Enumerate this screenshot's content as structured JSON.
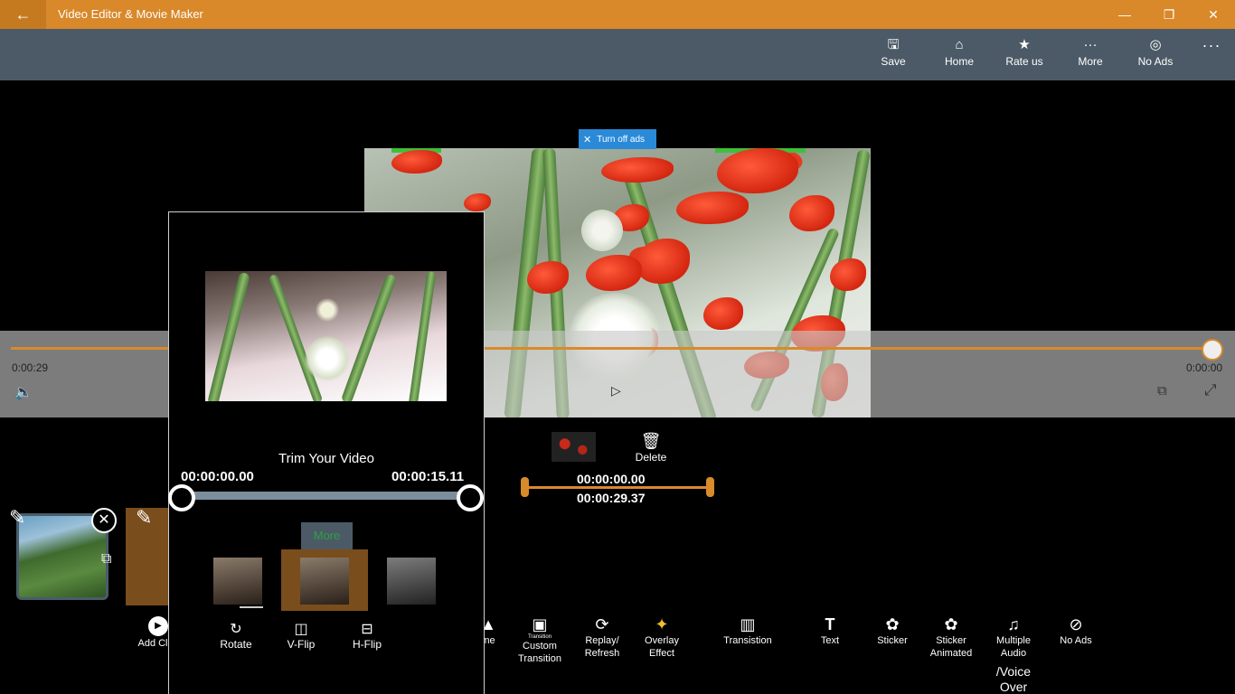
{
  "app": {
    "title": "Video Editor & Movie Maker",
    "back_icon": "back-arrow-icon"
  },
  "window_controls": {
    "minimize": "—",
    "restore": "❐",
    "close": "✕"
  },
  "command_bar": {
    "items": [
      {
        "label": "Save",
        "icon": "save-icon",
        "glyph": "🖫"
      },
      {
        "label": "Home",
        "icon": "home-icon",
        "glyph": "⌂"
      },
      {
        "label": "Rate us",
        "icon": "star-icon",
        "glyph": "★"
      },
      {
        "label": "More",
        "icon": "more-icon",
        "glyph": "···"
      },
      {
        "label": "No Ads",
        "icon": "no-ads-icon",
        "glyph": "◎"
      }
    ],
    "overflow": "···"
  },
  "ad": {
    "label": "Turn off ads",
    "close": "✕"
  },
  "player": {
    "time_elapsed": "0:00:29",
    "time_remaining": "0:00:00",
    "progress": 1.0,
    "volume_glyph": "🔈",
    "play_glyph": "▷",
    "cast_glyph": "⧉",
    "fullscreen_glyph": "⤢"
  },
  "clip_editor": {
    "delete_label": "Delete",
    "delete_glyph": "🗑",
    "start_time": "00:00:00.00",
    "end_time": "00:00:29.37"
  },
  "clips": {
    "add_label": "Add Cl",
    "add_glyph": "▶",
    "close_glyph": "✕",
    "edit_glyph": "✎",
    "copy_glyph": "⧉"
  },
  "toolbar": {
    "frame_label": "me",
    "custom_transition_label": "Custom Transition",
    "custom_transition_small": "Transition",
    "replay_label": "Replay/ Refresh",
    "overlay_label": "Overlay Effect",
    "transistion_label": "Transistion",
    "text_label": "Text",
    "sticker_label": "Sticker",
    "sticker_animated_label": "Sticker Animated",
    "multiple_audio_label": "Multiple Audio",
    "no_ads_label": "No Ads",
    "voice_over_label": "/Voice Over"
  },
  "trim_dialog": {
    "title": "Trim Your Video",
    "start_time": "00:00:00.00",
    "end_time": "00:00:15.11",
    "more_label": "More",
    "rotate_label": "Rotate",
    "vflip_label": "V-Flip",
    "hflip_label": "H-Flip"
  }
}
